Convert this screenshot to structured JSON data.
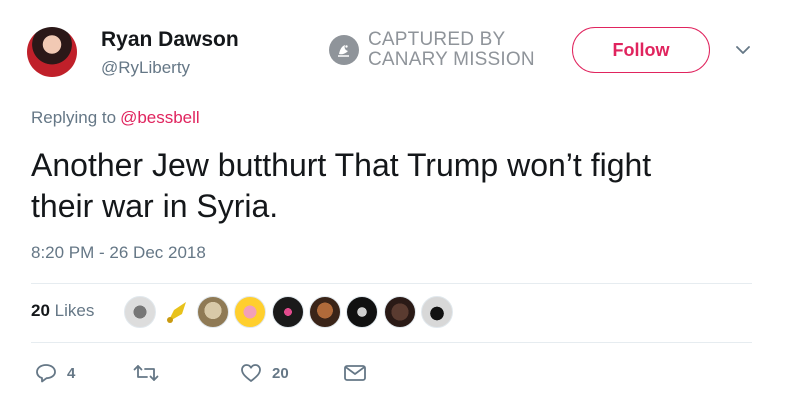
{
  "author": {
    "name": "Ryan Dawson",
    "handle": "@RyLiberty"
  },
  "watermark": {
    "line1": "CAPTURED BY",
    "line2": "CANARY MISSION",
    "color": "#8f949a"
  },
  "follow_button": {
    "label": "Follow",
    "color": "#e0245e"
  },
  "reply": {
    "prefix": "Replying to",
    "mention": "@bessbell"
  },
  "tweet": {
    "line1": "Another Jew butthurt That Trump won’t fight",
    "line2": "their war in Syria."
  },
  "timestamp": "8:20 PM - 26 Dec 2018",
  "likes": {
    "count": "20",
    "label": "Likes"
  },
  "actions": {
    "reply_count": "4",
    "retweet_count": "",
    "like_count": "20"
  },
  "icons": [
    "avatar",
    "canary-mission-logo-icon",
    "chevron-down-icon",
    "reply-icon",
    "retweet-icon",
    "heart-icon",
    "envelope-icon"
  ]
}
